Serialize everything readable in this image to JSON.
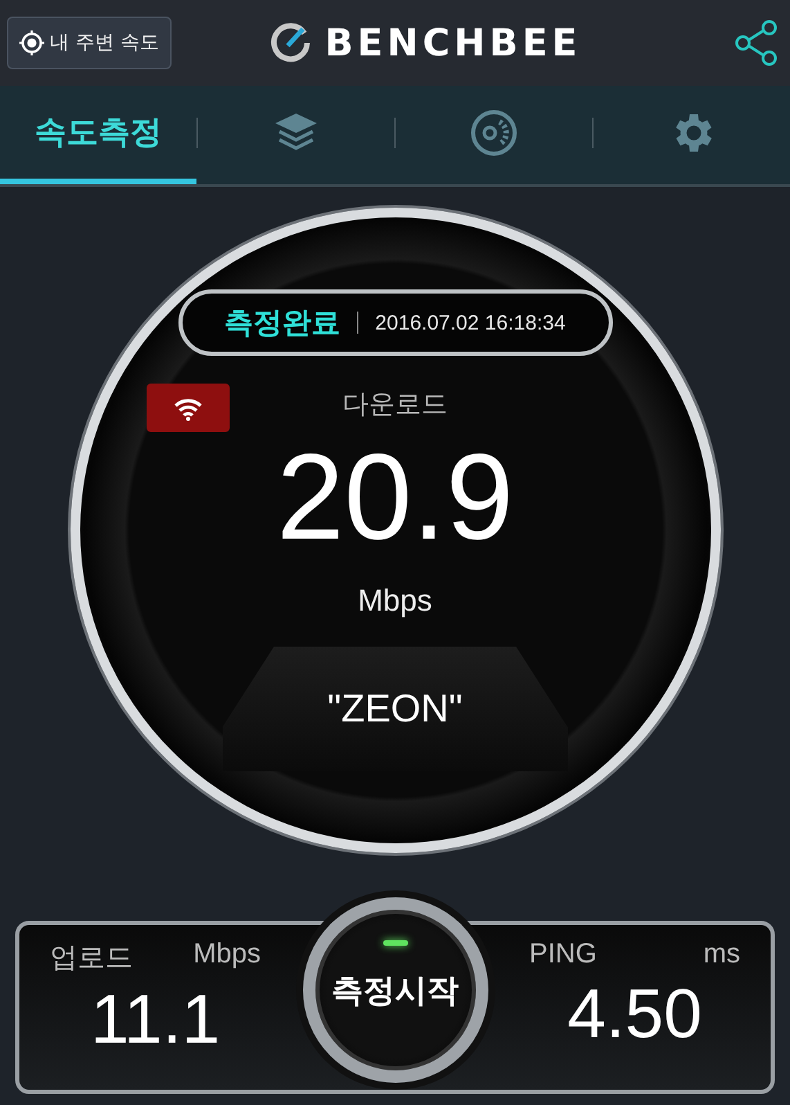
{
  "header": {
    "location_button": "내 주변 속도",
    "logo": "BENCHBEE"
  },
  "tabs": [
    {
      "kind": "text",
      "label": "속도측정",
      "selected": true
    },
    {
      "kind": "layers",
      "selected": false
    },
    {
      "kind": "disc",
      "selected": false
    },
    {
      "kind": "gear",
      "selected": false
    }
  ],
  "result": {
    "status": "측정완료",
    "timestamp": "2016.07.02 16:18:34",
    "network": {
      "kind": "wifi"
    },
    "label": "다운로드",
    "value": "20.9",
    "unit": "Mbps",
    "server": "\"ZEON\""
  },
  "upload": {
    "label": "업로드",
    "unit": "Mbps",
    "value": "11.1"
  },
  "ping": {
    "label": "PING",
    "unit": "ms",
    "value": "4.50"
  },
  "start_button": "측정시작"
}
